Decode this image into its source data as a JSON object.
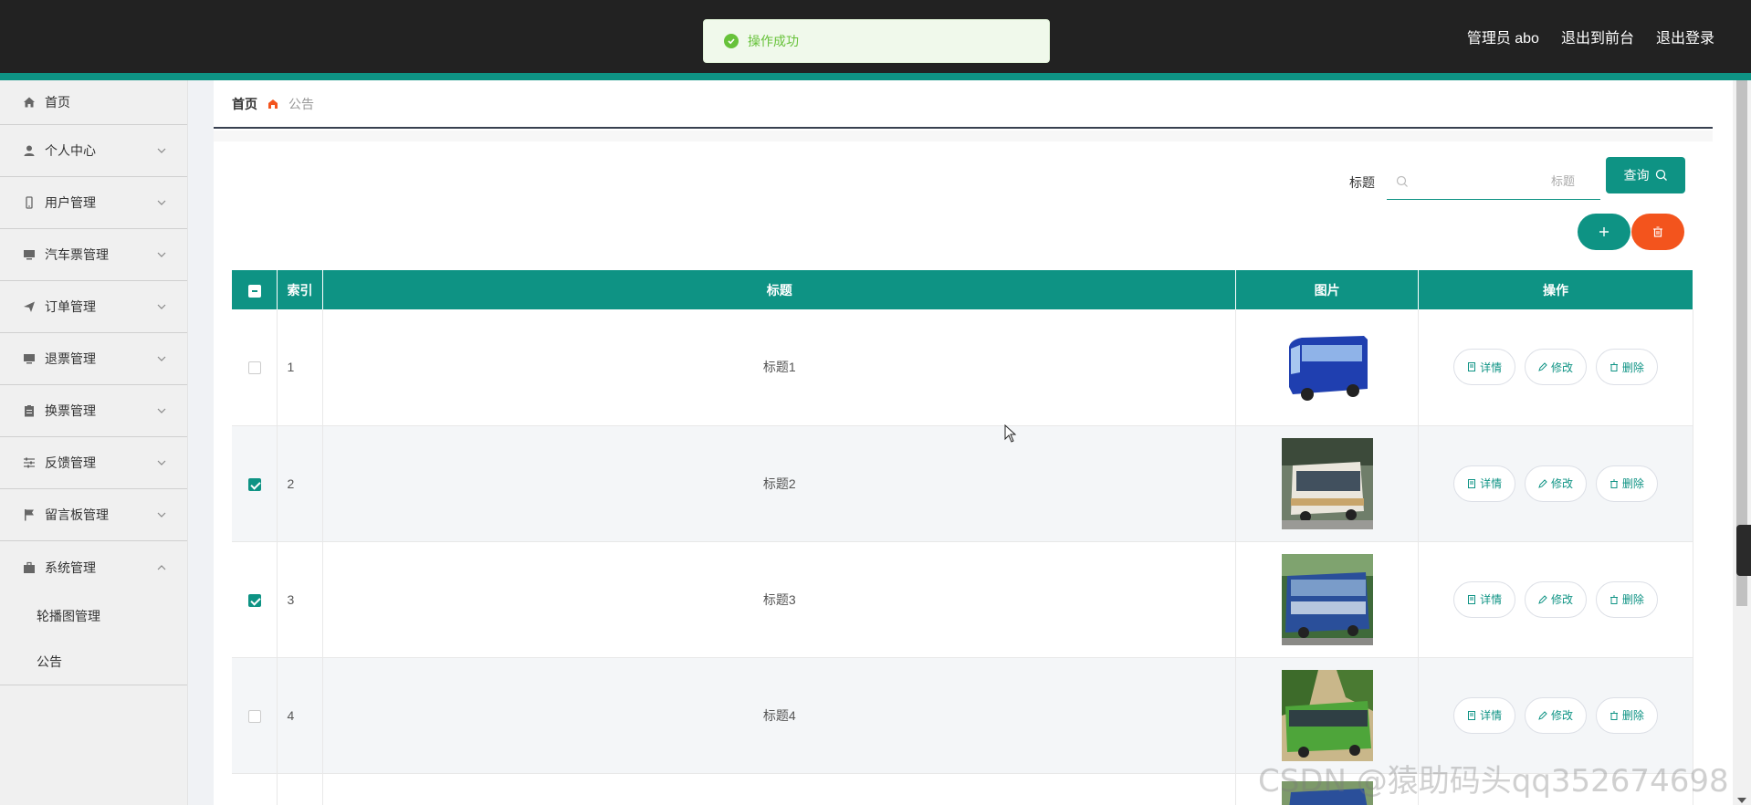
{
  "header": {
    "user_label": "管理员 abo",
    "front_link": "退出到前台",
    "logout_link": "退出登录"
  },
  "toast": {
    "message": "操作成功"
  },
  "sidebar": {
    "items": [
      {
        "label": "首页",
        "icon": "home-icon"
      },
      {
        "label": "个人中心",
        "icon": "user-icon"
      },
      {
        "label": "用户管理",
        "icon": "phone-icon"
      },
      {
        "label": "汽车票管理",
        "icon": "monitor-icon"
      },
      {
        "label": "订单管理",
        "icon": "send-icon"
      },
      {
        "label": "退票管理",
        "icon": "monitor-icon"
      },
      {
        "label": "换票管理",
        "icon": "clipboard-icon"
      },
      {
        "label": "反馈管理",
        "icon": "sliders-icon"
      },
      {
        "label": "留言板管理",
        "icon": "flag-icon"
      },
      {
        "label": "系统管理",
        "icon": "briefcase-icon"
      }
    ],
    "sub_items": [
      {
        "label": "轮播图管理"
      },
      {
        "label": "公告"
      }
    ]
  },
  "breadcrumb": {
    "home": "首页",
    "current": "公告"
  },
  "search": {
    "label": "标题",
    "placeholder": "标题",
    "button_label": "查询"
  },
  "table": {
    "headers": {
      "index": "索引",
      "title": "标题",
      "image": "图片",
      "ops": "操作"
    },
    "rows": [
      {
        "index": "1",
        "title": "标题1",
        "checked": false
      },
      {
        "index": "2",
        "title": "标题2",
        "checked": true
      },
      {
        "index": "3",
        "title": "标题3",
        "checked": true
      },
      {
        "index": "4",
        "title": "标题4",
        "checked": false
      }
    ],
    "ops": {
      "detail": "详情",
      "edit": "修改",
      "delete": "删除"
    }
  },
  "watermark": "CSDN @猿助码头qq352674698",
  "colors": {
    "accent": "#0e9384",
    "danger": "#f3541d",
    "toast": "#67c23a",
    "header": "#222222"
  }
}
